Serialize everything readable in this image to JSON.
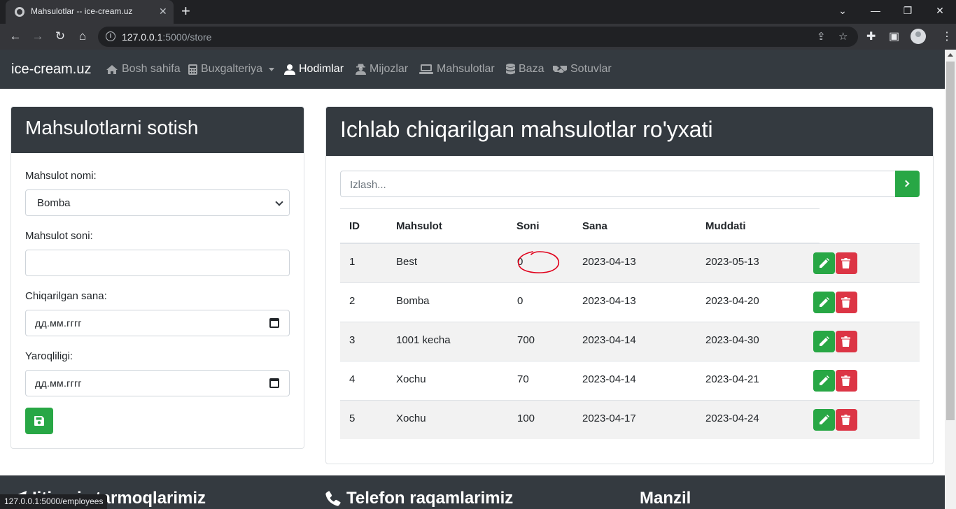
{
  "browser": {
    "tab_title": "Mahsulotlar -- ice-cream.uz",
    "url_host": "127.0.0.1",
    "url_path": ":5000/store",
    "status_url": "127.0.0.1:5000/employees"
  },
  "navbar": {
    "brand": "ice-cream.uz",
    "items": [
      {
        "label": "Bosh sahifa",
        "icon": "home-icon"
      },
      {
        "label": "Buxgalteriya",
        "icon": "calculator-icon",
        "dropdown": true
      },
      {
        "label": "Hodimlar",
        "icon": "user-icon",
        "active": true
      },
      {
        "label": "Mijozlar",
        "icon": "user-secret-icon"
      },
      {
        "label": "Mahsulotlar",
        "icon": "keyboard-icon"
      },
      {
        "label": "Baza",
        "icon": "database-icon"
      },
      {
        "label": "Sotuvlar",
        "icon": "handshake-icon"
      }
    ]
  },
  "sell_form": {
    "title": "Mahsulotlarni sotish",
    "product_name_label": "Mahsulot nomi:",
    "product_name_value": "Bomba",
    "quantity_label": "Mahsulot soni:",
    "quantity_value": "",
    "produced_date_label": "Chiqarilgan sana:",
    "produced_date_placeholder": "дд.мм.гггг",
    "expiry_label": "Yaroqliligi:",
    "expiry_placeholder": "дд.мм.гггг",
    "save_icon": "save-icon"
  },
  "products": {
    "title": "Ichlab chiqarilgan mahsulotlar ro'yxati",
    "search_placeholder": "Izlash...",
    "columns": [
      "ID",
      "Mahsulot",
      "Soni",
      "Sana",
      "Muddati"
    ],
    "rows": [
      {
        "id": "1",
        "name": "Best",
        "qty": "0",
        "date": "2023-04-13",
        "expiry": "2023-05-13"
      },
      {
        "id": "2",
        "name": "Bomba",
        "qty": "0",
        "date": "2023-04-13",
        "expiry": "2023-04-20"
      },
      {
        "id": "3",
        "name": "1001 kecha",
        "qty": "700",
        "date": "2023-04-14",
        "expiry": "2023-04-30"
      },
      {
        "id": "4",
        "name": "Xochu",
        "qty": "70",
        "date": "2023-04-14",
        "expiry": "2023-04-21"
      },
      {
        "id": "5",
        "name": "Xochu",
        "qty": "100",
        "date": "2023-04-17",
        "expiry": "2023-04-24"
      }
    ]
  },
  "footer": {
    "social_title": "Ijtimoiy tarmoqlarimiz",
    "phone_title": "Telefon raqamlarimiz",
    "address_title": "Manzil"
  },
  "colors": {
    "dark": "#343a40",
    "success": "#28a745",
    "danger": "#dc3545",
    "annotation": "#e0001b"
  }
}
